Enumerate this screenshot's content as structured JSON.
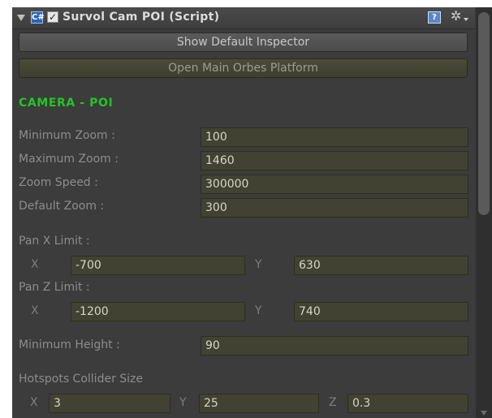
{
  "header": {
    "title": "Survol Cam POI (Script)",
    "script_icon": "C#",
    "checkbox_mark": "✓",
    "help_icon_glyph": "?",
    "gear_icon_glyph": "✲"
  },
  "buttons": {
    "show_default_inspector": "Show Default Inspector",
    "open_main_platform": "Open Main Orbes Platform"
  },
  "section": {
    "heading": "CAMERA - POI"
  },
  "zoom": {
    "minimum": {
      "label": "Minimum Zoom :",
      "value": "100"
    },
    "maximum": {
      "label": "Maximum Zoom :",
      "value": "1460"
    },
    "speed": {
      "label": "Zoom Speed :",
      "value": "300000"
    },
    "default": {
      "label": "Default Zoom :",
      "value": "300"
    }
  },
  "pan_x": {
    "label": "Pan X Limit :",
    "x_label": "X",
    "x": "-700",
    "y_label": "Y",
    "y": "630"
  },
  "pan_z": {
    "label": "Pan Z Limit :",
    "x_label": "X",
    "x": "-1200",
    "y_label": "Y",
    "y": "740"
  },
  "min_height": {
    "label": "Minimum Height :",
    "value": "90"
  },
  "hotspots": {
    "label": "Hotspots Collider Size",
    "x_label": "X",
    "x": "3",
    "y_label": "Y",
    "y": "25",
    "z_label": "Z",
    "z": "0.3"
  },
  "colors": {
    "panel_bg": "#3c3c3c",
    "field_bg": "#424232",
    "heading_green": "#22c522",
    "label_gray": "#8c8c8c"
  }
}
